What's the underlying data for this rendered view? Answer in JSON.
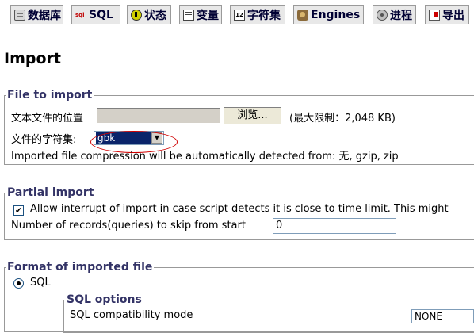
{
  "tabs": [
    {
      "label": "数据库",
      "icon": "database-icon"
    },
    {
      "label": "SQL",
      "icon": "sql-icon"
    },
    {
      "label": "状态",
      "icon": "status-icon"
    },
    {
      "label": "变量",
      "icon": "variables-icon"
    },
    {
      "label": "字符集",
      "icon": "charset-icon"
    },
    {
      "label": "Engines",
      "icon": "engines-icon"
    },
    {
      "label": "进程",
      "icon": "processes-icon"
    },
    {
      "label": "导出",
      "icon": "export-icon"
    }
  ],
  "page_title": "Import",
  "file_to_import": {
    "legend": "File to import",
    "location_label": "文本文件的位置",
    "browse_label": "浏览...",
    "max_size": "(最大限制：2,048 KB)",
    "charset_label": "文件的字符集:",
    "charset_value": "gbk",
    "compression_text": "Imported file compression will be automatically detected from: 无, gzip, zip"
  },
  "partial_import": {
    "legend": "Partial import",
    "allow_interrupt_checked": true,
    "allow_interrupt_label": "Allow interrupt of import in case script detects it is close to time limit. This might",
    "skip_label": "Number of records(queries) to skip from start",
    "skip_value": "0"
  },
  "format": {
    "legend": "Format of imported file",
    "sql_label": "SQL",
    "sql_options_legend": "SQL options",
    "compat_label": "SQL compatibility mode",
    "compat_value": "NONE"
  },
  "colors": {
    "annotation_ellipse": "#d00000",
    "selection": "#0a246a",
    "legend_text": "#333366"
  }
}
